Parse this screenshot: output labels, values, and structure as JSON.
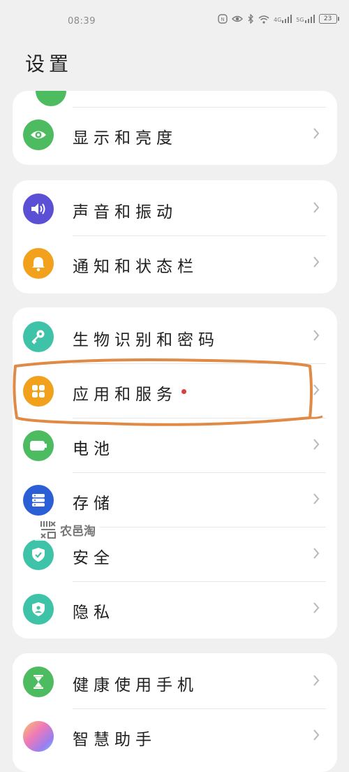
{
  "status_bar": {
    "time": "08:39",
    "battery": "23",
    "signal_a": "4G",
    "signal_b": "5G"
  },
  "page": {
    "title": "设置"
  },
  "cards": [
    {
      "items": [
        {
          "label": "显示和亮度",
          "icon": "eye-icon",
          "color": "#4dbb60"
        }
      ]
    },
    {
      "items": [
        {
          "label": "声音和振动",
          "icon": "speaker-icon",
          "color": "#5b4fd6"
        },
        {
          "label": "通知和状态栏",
          "icon": "bell-icon",
          "color": "#f2a11c"
        }
      ]
    },
    {
      "items": [
        {
          "label": "生物识别和密码",
          "icon": "key-icon",
          "color": "#3ec3a8"
        },
        {
          "label": "应用和服务",
          "icon": "apps-grid-icon",
          "color": "#f2a11c",
          "badge": "red-dot"
        },
        {
          "label": "电池",
          "icon": "battery-icon",
          "color": "#4dbb60"
        },
        {
          "label": "存储",
          "icon": "storage-icon",
          "color": "#2a5fd6"
        },
        {
          "label": "安全",
          "icon": "shield-check-icon",
          "color": "#3ec3a8"
        },
        {
          "label": "隐私",
          "icon": "privacy-shield-icon",
          "color": "#3ec3a8"
        }
      ]
    },
    {
      "items": [
        {
          "label": "健康使用手机",
          "icon": "hourglass-icon",
          "color": "#4dbb60"
        },
        {
          "label": "智慧助手",
          "icon": "assistant-orb-icon",
          "color": "#b77fe0"
        }
      ]
    }
  ],
  "annotation": {
    "color": "#e08a45"
  },
  "watermark": {
    "text": "农邑淘"
  }
}
